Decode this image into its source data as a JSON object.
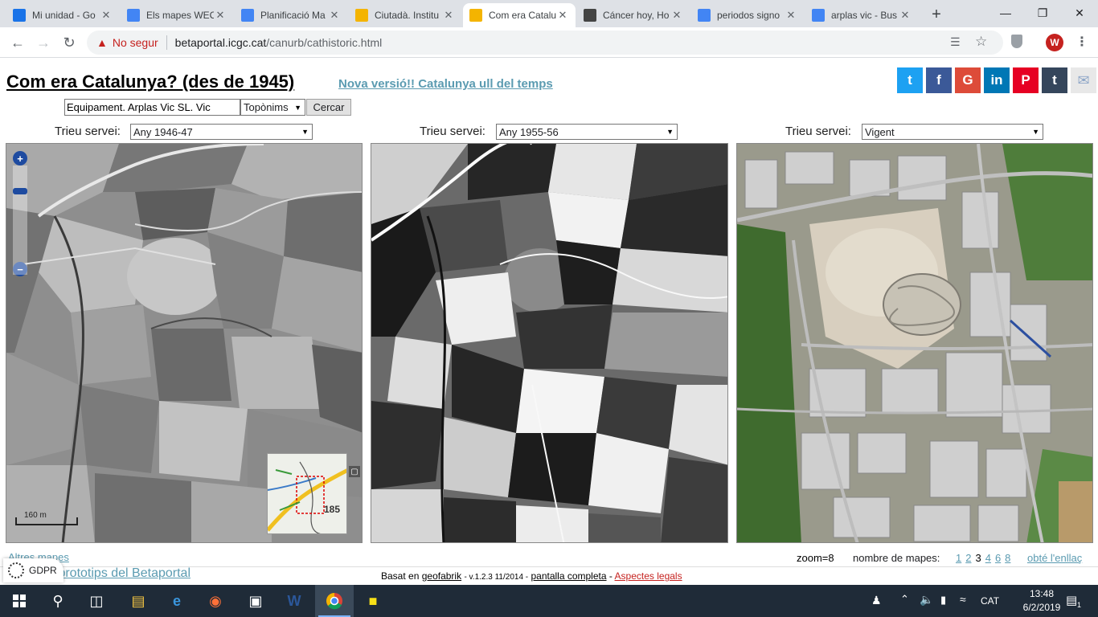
{
  "browser": {
    "tabs": [
      {
        "title": "Mi unidad - Go",
        "icon": "google-drive-icon",
        "color": "#1a73e8"
      },
      {
        "title": "Els mapes WEC",
        "icon": "google-docs-icon",
        "color": "#4285f4"
      },
      {
        "title": "Planificació Ma",
        "icon": "google-docs-icon",
        "color": "#4285f4"
      },
      {
        "title": "Ciutadà. Institu",
        "icon": "icgc-icon",
        "color": "#f4b400"
      },
      {
        "title": "Com era Catalu",
        "icon": "loading-icon",
        "color": "#f4b400"
      },
      {
        "title": "Cáncer hoy, Ho",
        "icon": "abc-icon",
        "color": "#444444"
      },
      {
        "title": "periodos signo",
        "icon": "google-icon",
        "color": "#4285f4"
      },
      {
        "title": "arplas vic - Bus",
        "icon": "google-icon",
        "color": "#4285f4"
      }
    ],
    "new_tab": "+",
    "security_label": "No segur",
    "url_host": "betaportal.icgc.cat",
    "url_path": "/canurb/cathistoric.html",
    "profile_initial": "W"
  },
  "page": {
    "title": "Com era Catalunya? (des de 1945)",
    "new_version_link": "Nova versió!! Catalunya ull del temps",
    "share_buttons": [
      {
        "icon": "twitter-icon",
        "glyph": "t",
        "color": "#1da1f2"
      },
      {
        "icon": "facebook-icon",
        "glyph": "f",
        "color": "#3b5998"
      },
      {
        "icon": "google-plus-icon",
        "glyph": "G",
        "color": "#dd4b39"
      },
      {
        "icon": "linkedin-icon",
        "glyph": "in",
        "color": "#0077b5"
      },
      {
        "icon": "pinterest-icon",
        "glyph": "P",
        "color": "#e60023"
      },
      {
        "icon": "tumblr-icon",
        "glyph": "t",
        "color": "#35465c"
      },
      {
        "icon": "email-icon",
        "glyph": "✉",
        "color": "#e8e8e8"
      }
    ]
  },
  "search": {
    "value": "Equipament. Arplas Vic SL. Vic",
    "type_selected": "Topònims",
    "button_label": "Cercar"
  },
  "maps": [
    {
      "label": "Trieu servei:",
      "selected": "Any 1946-47"
    },
    {
      "label": "Trieu servei:",
      "selected": "Any 1955-56"
    },
    {
      "label": "Trieu servei:",
      "selected": "Vigent"
    }
  ],
  "map_overlay": {
    "scale_label": "160 m",
    "locator_label": "185"
  },
  "status": {
    "zoom_text": "zoom=8",
    "maps_count_label": "nombre de mapes:",
    "map_counts": [
      "1",
      "2",
      "3",
      "4",
      "6",
      "8"
    ],
    "current_count": "3",
    "link_label": "obté l'enllaç",
    "left_link_partial": "Altres mapes",
    "prototypes_link": "s prototips del Betaportal"
  },
  "footer": {
    "based_on": "Basat en",
    "geofabrik": "geofabrik",
    "version": "- v.1.2.3 11/2014 -",
    "fullscreen": "pantalla completa",
    "dash": "-",
    "legal": "Aspectes legals"
  },
  "gdpr": {
    "label": "GDPR"
  },
  "taskbar": {
    "language": "CAT",
    "time": "13:48",
    "date": "6/2/2019",
    "notifications": "1"
  }
}
